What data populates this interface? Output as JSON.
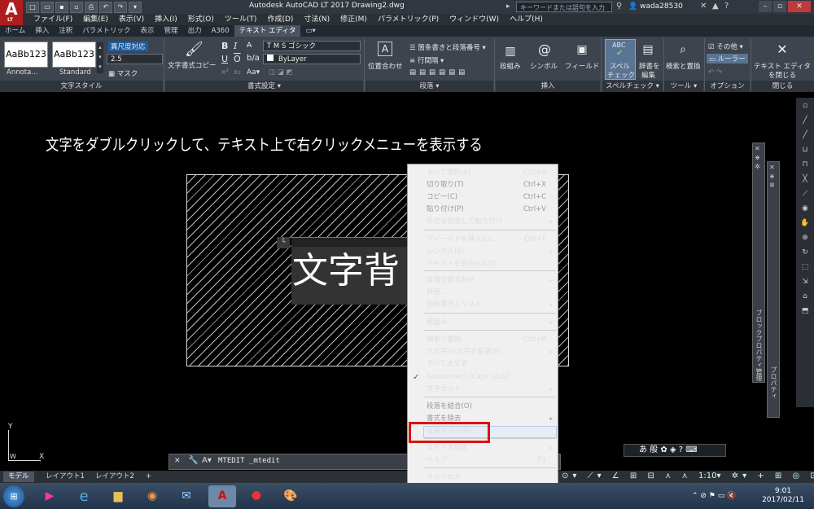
{
  "titlebar": {
    "app_title": "Autodesk AutoCAD LT 2017    Drawing2.dwg",
    "search_placeholder": "キーワードまたは語句を入力",
    "user": "wada28530",
    "logo_letter": "A",
    "logo_sub": "LT"
  },
  "menubar": [
    "ファイル(F)",
    "編集(E)",
    "表示(V)",
    "挿入(I)",
    "形式(O)",
    "ツール(T)",
    "作成(D)",
    "寸法(N)",
    "修正(M)",
    "パラメトリック(P)",
    "ウィンドウ(W)",
    "ヘルプ(H)"
  ],
  "ribbon_tabs": [
    "ホーム",
    "挿入",
    "注釈",
    "パラメトリック",
    "表示",
    "管理",
    "出力",
    "A360",
    "テキスト エディタ"
  ],
  "ribbon": {
    "style1": "AaBb123",
    "style1_label": "Annota...",
    "style2": "AaBb123",
    "style2_label": "Standard",
    "annotative": "異尺度対応",
    "height": "2.5",
    "mask": "マスク",
    "match_format": "文字書式コピー",
    "font": "M S ゴシック",
    "color": "ByLayer",
    "bullets": "箇条書きと段落番号",
    "line_spacing": "行間隔",
    "justify": "位置合わせ",
    "columns": "段組み",
    "symbol": "シンボル",
    "field": "フィールド",
    "spell": "スペル\nチェック",
    "spell_line1": "スペル",
    "spell_line2": "チェック",
    "dictionary_line1": "辞書を",
    "dictionary_line2": "編集",
    "find_replace": "検索と置換",
    "more": "その他",
    "ruler": "ルーラー",
    "close_line1": "テキスト エディタ",
    "close_line2": "を閉じる",
    "panels": {
      "text_style": "文字スタイル",
      "formatting": "書式設定 ▾",
      "paragraph": "段落 ▾",
      "insert": "挿入",
      "spell_check": "スペルチェック ▾",
      "tools": "ツール ▾",
      "options": "オプション",
      "close": "閉じる"
    }
  },
  "canvas": {
    "heading": "文字をダブルクリックして、テキスト上で右クリックメニューを表示する",
    "editor_text": "文字背"
  },
  "context_menu": [
    {
      "label": "すべて選択(A)",
      "shortcut": "Ctrl+A",
      "disabled": false
    },
    {
      "label": "切り取り(T)",
      "shortcut": "Ctrl+X",
      "disabled": true
    },
    {
      "label": "コピー(C)",
      "shortcut": "Ctrl+C",
      "disabled": true
    },
    {
      "label": "貼り付け(P)",
      "shortcut": "Ctrl+V",
      "disabled": true
    },
    {
      "label": "形式を指定して貼り付け",
      "shortcut": "▸",
      "disabled": false
    },
    {
      "label": "フィールドを挿入(L)...",
      "shortcut": "Ctrl+F",
      "disabled": false
    },
    {
      "label": "シンボル(S)",
      "shortcut": "▸",
      "disabled": false
    },
    {
      "label": "テキストを読み込む(I)...",
      "shortcut": "",
      "disabled": false
    },
    {
      "label": "段落位置合わせ",
      "shortcut": "▸",
      "disabled": false
    },
    {
      "label": "段落...",
      "shortcut": "",
      "disabled": false
    },
    {
      "label": "箇条書きとリスト",
      "shortcut": "▸",
      "disabled": false
    },
    {
      "label": "段組み",
      "shortcut": "▸",
      "disabled": false
    },
    {
      "label": "検索と置換...",
      "shortcut": "Ctrl+R",
      "disabled": false
    },
    {
      "label": "大文字/小文字を変更(H)",
      "shortcut": "▸",
      "disabled": false
    },
    {
      "label": "すべて大文字",
      "shortcut": "",
      "disabled": false
    },
    {
      "label": "Autocorrect [Caps Lock]",
      "shortcut": "",
      "disabled": false,
      "checked": true
    },
    {
      "label": "文字セット",
      "shortcut": "▸",
      "disabled": false
    },
    {
      "label": "段落を結合(O)",
      "shortcut": "",
      "disabled": true
    },
    {
      "label": "書式を除去",
      "shortcut": "▸",
      "disabled": true
    },
    {
      "label": "背景マスク(B)...",
      "shortcut": "",
      "disabled": false
    },
    {
      "label": "エディタ設定",
      "shortcut": "▸",
      "disabled": false
    },
    {
      "label": "ヘルプ",
      "shortcut": "F1",
      "disabled": false
    },
    {
      "label": "キャンセル",
      "shortcut": "",
      "disabled": false
    }
  ],
  "command_line": {
    "text": "MTEDIT _mtedit"
  },
  "layout_tabs": [
    "モデル",
    "レイアウト1",
    "レイアウト2",
    "+"
  ],
  "statusbar": {
    "scale": "1:10"
  },
  "palettes": {
    "properties": "ブロックプロパティ管理",
    "properties2": "プロパティ"
  },
  "taskbar": {
    "time": "9:01",
    "date": "2017/02/11"
  },
  "colors": {
    "highlight_box": "#e01010",
    "canvas": "#000000",
    "ribbon": "#3d444e"
  }
}
